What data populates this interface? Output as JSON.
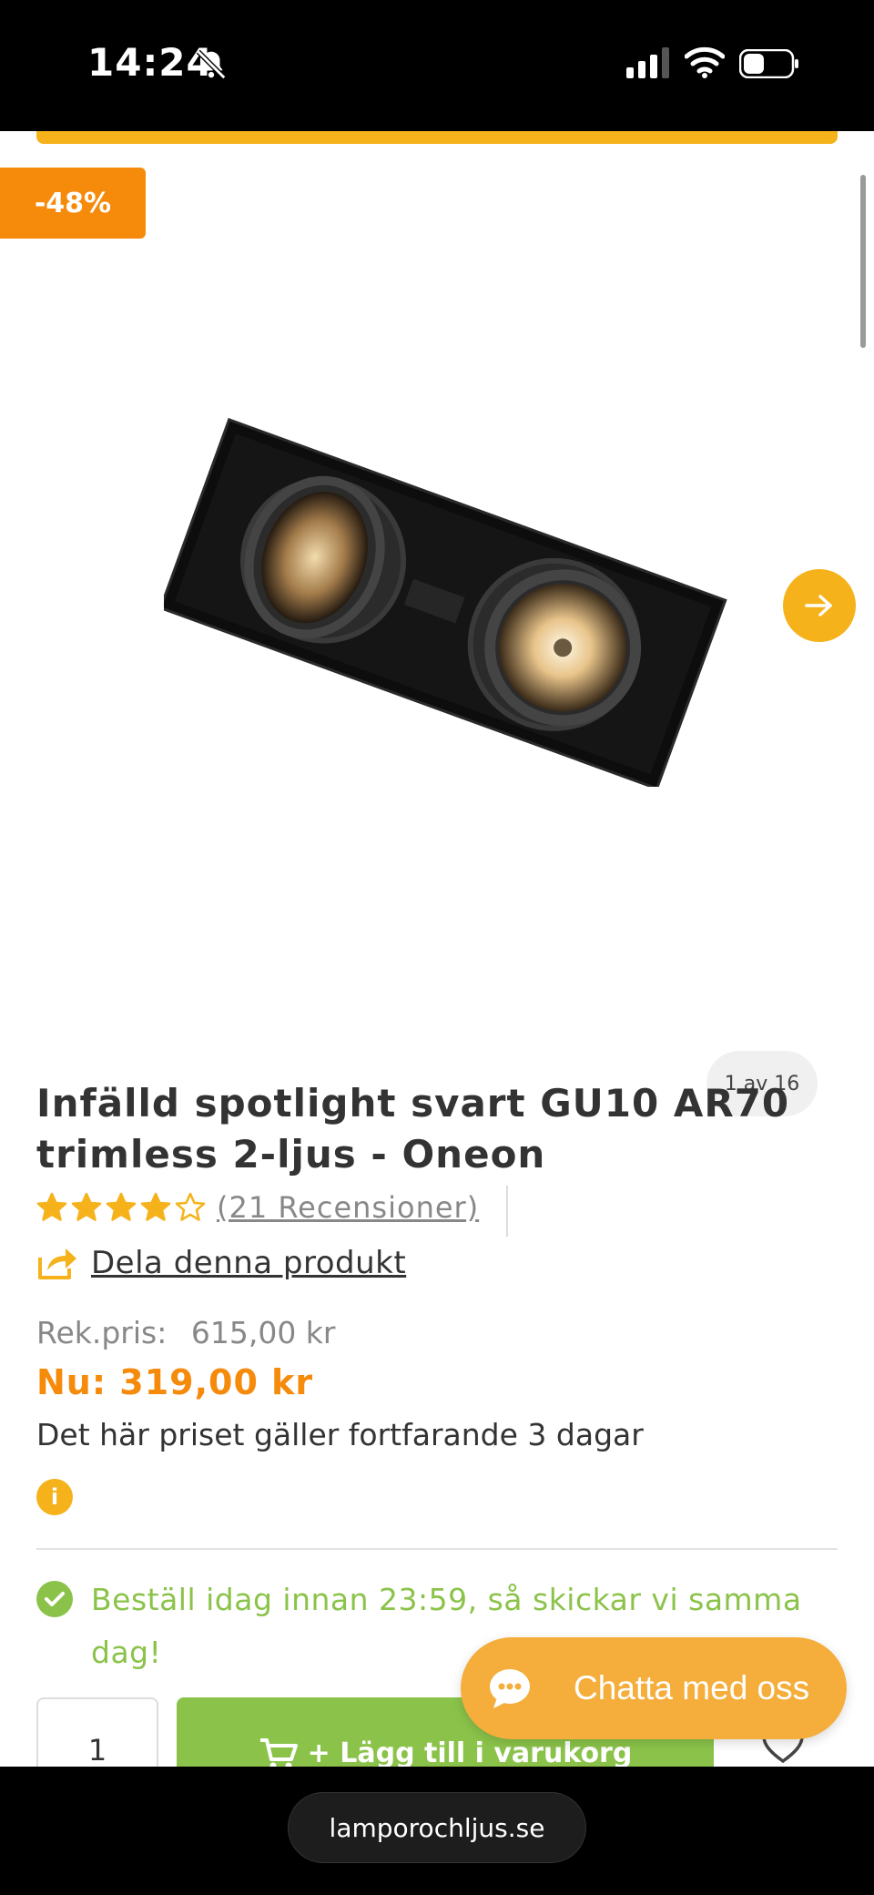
{
  "status_bar": {
    "time": "14:24"
  },
  "product": {
    "discount_badge": "-48%",
    "image_counter": "1 av 16",
    "title": "Infälld spotlight svart GU10 AR70 trimless 2-ljus - Oneon",
    "rating": 4.5,
    "rating_max": 5,
    "reviews_label": "(21 Recensioner)",
    "share_label": "Dela denna produkt",
    "rek_pris_label": "Rek.pris:",
    "rek_pris_value": "615,00 kr",
    "now_price": "Nu: 319,00 kr",
    "price_note": "Det här priset gäller fortfarande 3 dagar",
    "info_icon_label": "i",
    "shipping_text": "Beställ idag innan 23:59, så skickar vi samma dag!",
    "quantity": "1",
    "add_to_cart_label": "+ Lägg till i varukorg"
  },
  "chat": {
    "label": "Chatta med oss"
  },
  "browser": {
    "url": "lamporochljus.se"
  },
  "colors": {
    "accent_yellow": "#f5b21b",
    "discount_orange": "#f58a0b",
    "success_green": "#8bc34a",
    "chat_orange": "#f5ae3b"
  },
  "icons": {
    "next": "arrow-right-icon",
    "share": "share-icon",
    "info": "info-icon",
    "check": "check-icon",
    "cart": "cart-icon",
    "wishlist": "heart-icon",
    "chat": "chat-bubble-icon"
  }
}
